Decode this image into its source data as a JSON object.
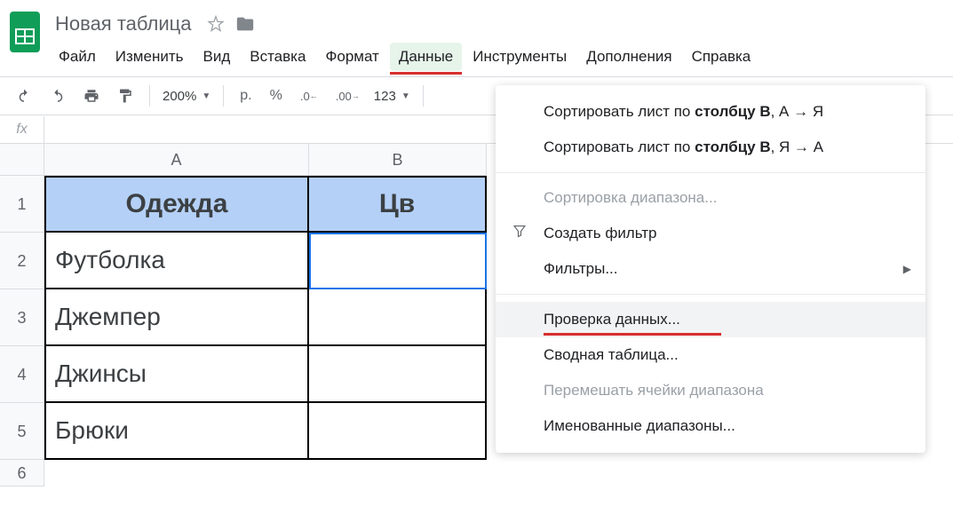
{
  "document": {
    "title": "Новая таблица"
  },
  "menubar": {
    "items": [
      "Файл",
      "Изменить",
      "Вид",
      "Вставка",
      "Формат",
      "Данные",
      "Инструменты",
      "Дополнения",
      "Справка"
    ],
    "active_index": 5
  },
  "toolbar": {
    "zoom": "200%",
    "currency": "р.",
    "percent": "%",
    "dec_minus": ".0",
    "dec_plus": ".00",
    "num_format": "123"
  },
  "formula": {
    "fx": "fx",
    "value": ""
  },
  "columns": {
    "a": "A",
    "b": "B"
  },
  "cells": {
    "a1": "Одежда",
    "b1": "Цв",
    "a2": "Футболка",
    "a3": "Джемпер",
    "a4": "Джинсы",
    "a5": "Брюки"
  },
  "row_nums": [
    "1",
    "2",
    "3",
    "4",
    "5",
    "6"
  ],
  "dropdown": {
    "sort_asc_pre": "Сортировать лист по ",
    "sort_col": "столбцу B",
    "sort_asc_suf": ", А → Я",
    "sort_desc_suf": ", Я → А",
    "sort_range": "Сортировка диапазона...",
    "create_filter": "Создать фильтр",
    "filters": "Фильтры...",
    "data_validation": "Проверка данных...",
    "pivot": "Сводная таблица...",
    "shuffle": "Перемешать ячейки диапазона",
    "named_ranges": "Именованные диапазоны..."
  }
}
